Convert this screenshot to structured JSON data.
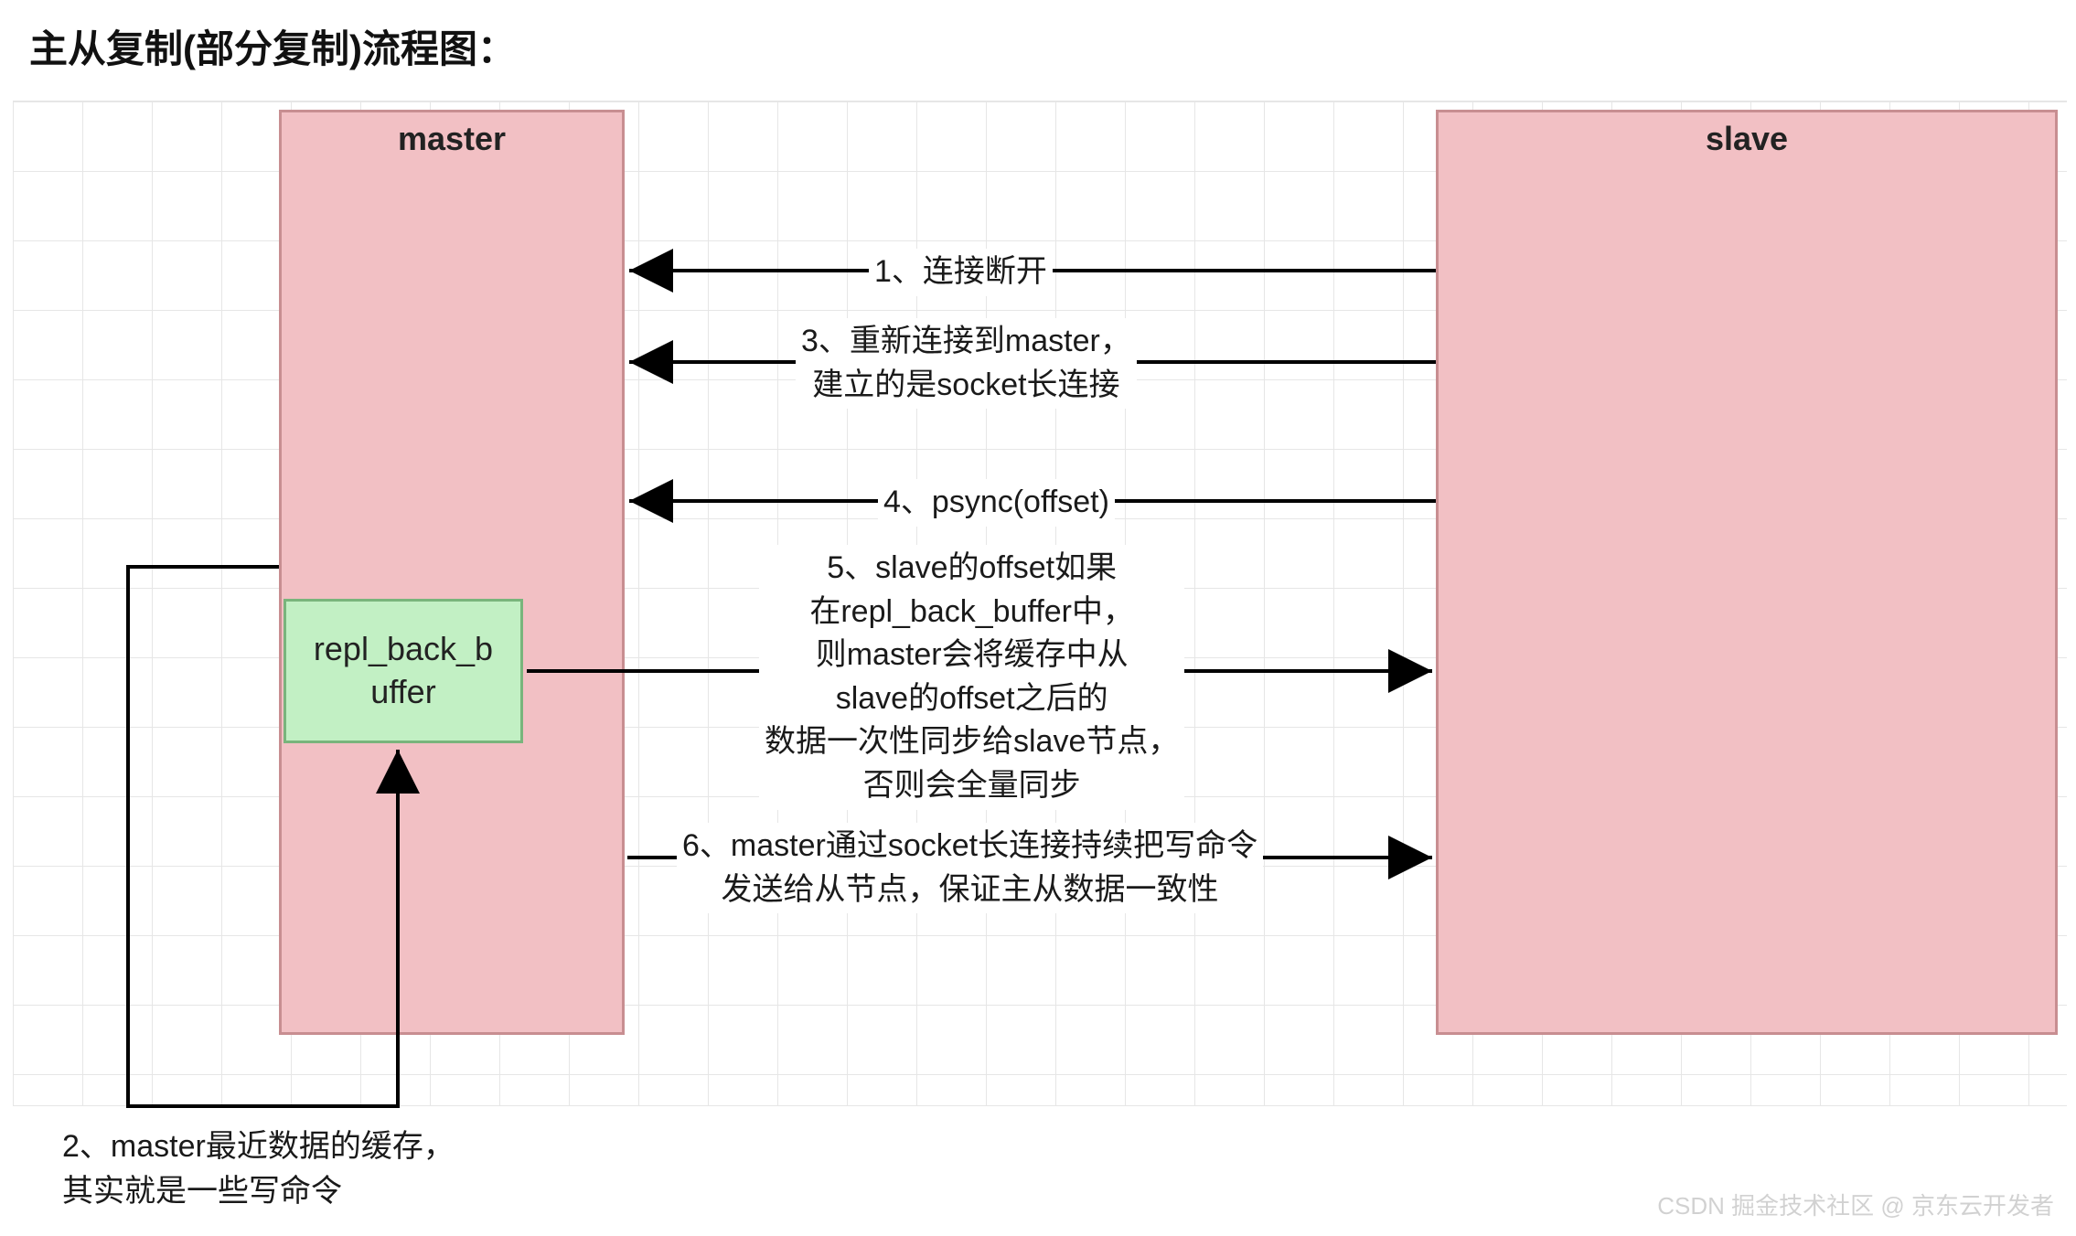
{
  "title": "主从复制(部分复制)流程图：",
  "nodes": {
    "master": "master",
    "slave": "slave",
    "repl_buffer": "repl_back_b\nuffer"
  },
  "steps": {
    "s1": "1、连接断开",
    "s2": "2、master最近数据的缓存，\n其实就是一些写命令",
    "s3": "3、重新连接到master，\n建立的是socket长连接",
    "s4": "4、psync(offset)",
    "s5": "5、slave的offset如果\n在repl_back_buffer中，\n则master会将缓存中从\nslave的offset之后的\n数据一次性同步给slave节点，\n否则会全量同步",
    "s6": "6、master通过socket长连接持续把写命令\n发送给从节点，保证主从数据一致性"
  },
  "watermark": "CSDN 掘金技术社区 @ 京东云开发者"
}
